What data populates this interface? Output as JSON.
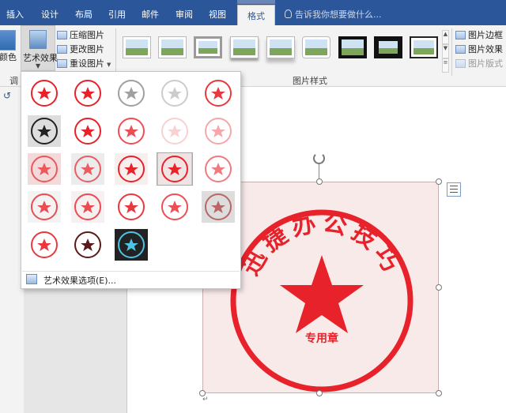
{
  "ribbon": {
    "tabs": [
      "插入",
      "设计",
      "布局",
      "引用",
      "邮件",
      "审阅",
      "视图",
      "格式"
    ],
    "active_tab": "格式",
    "tell_me": "告诉我你想要做什么...",
    "color_label": "颜色",
    "art_effects_label": "艺术效果",
    "compress_label": "压缩图片",
    "change_label": "更改图片",
    "reset_label": "重设图片",
    "adjust_group_label": "调",
    "styles_group_label": "图片样式",
    "border_label": "图片边框",
    "effect_label": "图片效果",
    "layout_label": "图片版式"
  },
  "gallery": {
    "options_label": "艺术效果选项(E)..."
  },
  "stamp": {
    "title": "迅捷办公技巧",
    "subtitle": "专用章",
    "color": "#e8222a"
  },
  "colors": {
    "ribbon_blue": "#2b579a",
    "stamp_red": "#e8222a"
  }
}
